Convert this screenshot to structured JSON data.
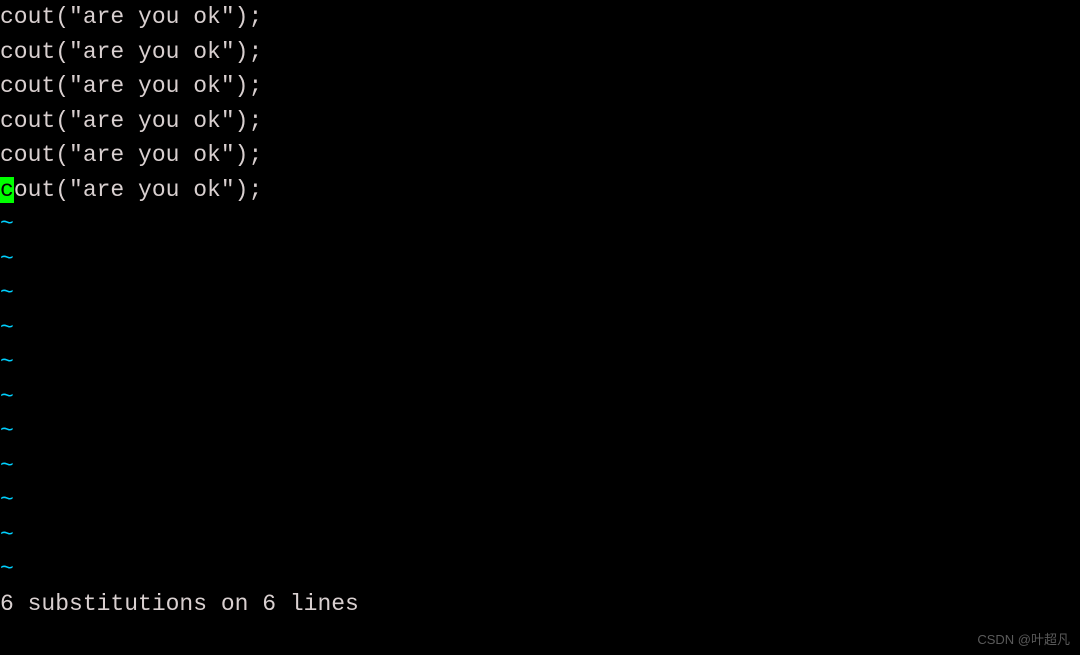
{
  "editor": {
    "lines": [
      "cout(\"are you ok\");",
      "cout(\"are you ok\");",
      "cout(\"are you ok\");",
      "cout(\"are you ok\");",
      "cout(\"are you ok\");"
    ],
    "cursor_line": {
      "cursor_char": "c",
      "rest": "out(\"are you ok\");"
    },
    "tilde": "~",
    "tilde_count": 11
  },
  "status": {
    "message": "6 substitutions on 6 lines"
  },
  "watermark": "CSDN @叶超凡"
}
